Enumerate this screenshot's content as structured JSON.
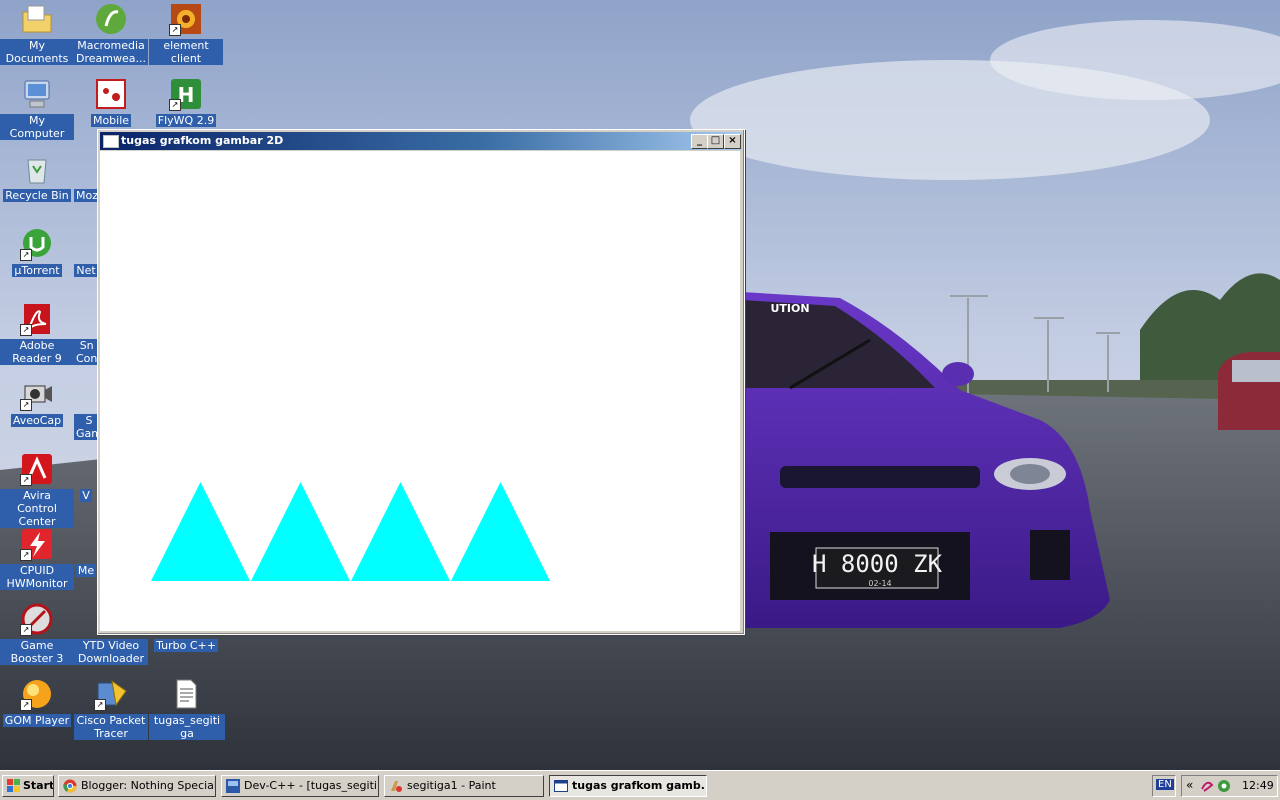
{
  "desktop_icons": [
    {
      "label": "My Documents"
    },
    {
      "label": "Macromedia Dreamwea..."
    },
    {
      "label": "element client"
    },
    {
      "label": "My Computer"
    },
    {
      "label": "Mobile"
    },
    {
      "label": "FlyWQ 2.9"
    },
    {
      "label": "Recycle Bin"
    },
    {
      "label": "Moz"
    },
    {
      "label": "µTorrent"
    },
    {
      "label": "Net"
    },
    {
      "label": "Adobe Reader 9"
    },
    {
      "label": "Sn Con"
    },
    {
      "label": "AveoCap"
    },
    {
      "label": "S Gam"
    },
    {
      "label": "Avira Control Center"
    },
    {
      "label": "V"
    },
    {
      "label": "CPUID HWMonitor"
    },
    {
      "label": "Me"
    },
    {
      "label": "Game Booster 3"
    },
    {
      "label": "YTD Video Downloader"
    },
    {
      "label": "Turbo C++"
    },
    {
      "label": "GOM Player"
    },
    {
      "label": "Cisco Packet Tracer"
    },
    {
      "label": "tugas_segitiga"
    }
  ],
  "window": {
    "title": "tugas grafkom gambar 2D",
    "minimize_label": "_",
    "maximize_label": "□",
    "close_label": "×",
    "triangle_color": "#00ffff",
    "triangle_count": 4
  },
  "wallpaper": {
    "plate_text": "H 8000 ZK",
    "plate_sub": "02-14",
    "banner_text": "UTION"
  },
  "taskbar": {
    "start_label": "Start",
    "items": [
      {
        "label": "Blogger: Nothing Special ..."
      },
      {
        "label": "Dev-C++ - [tugas_segiti..."
      },
      {
        "label": "segitiga1 - Paint"
      },
      {
        "label": "tugas grafkom gamb..."
      }
    ],
    "language": "EN",
    "chevron": "«",
    "clock": "12:49"
  }
}
